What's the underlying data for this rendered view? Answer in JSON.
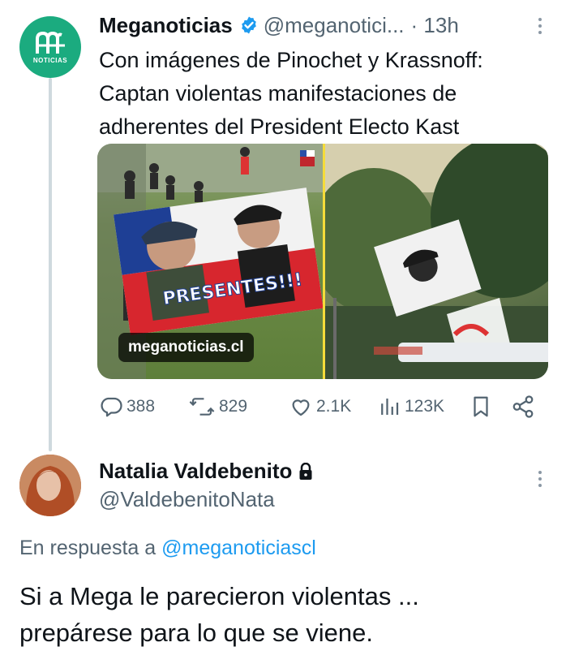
{
  "tweet": {
    "author_name": "Meganoticias",
    "author_handle": "@meganotici...",
    "time": "· 13h",
    "avatar_brand": "NOTICIAS",
    "text_lines": [
      "Con imágenes de Pinochet y Krassnoff:",
      "Captan violentas manifestaciones de",
      "adherentes del President Electo Kast"
    ],
    "media": {
      "left_banner_text": "PRESENTES!!!",
      "watermark": "meganoticias.cl"
    },
    "actions": {
      "replies": "388",
      "reposts": "829",
      "likes": "2.1K",
      "views": "123K"
    }
  },
  "reply": {
    "author_name": "Natalia Valdebenito",
    "author_handle": "@ValdebenitoNata",
    "in_reply_prefix": "En respuesta a",
    "in_reply_mention": "@meganoticiascl",
    "text_lines": [
      "Si a Mega le parecieron violentas ...",
      "prepárese para lo que se viene."
    ]
  },
  "colors": {
    "brand_green": "#1bab7f",
    "link_blue": "#1d9bf0",
    "muted_gray": "#536471",
    "thread_line": "#cfd9de"
  },
  "icons": [
    "verified-badge-icon",
    "more-icon",
    "reply-icon",
    "repost-icon",
    "like-icon",
    "views-icon",
    "bookmark-icon",
    "share-icon",
    "lock-icon"
  ]
}
